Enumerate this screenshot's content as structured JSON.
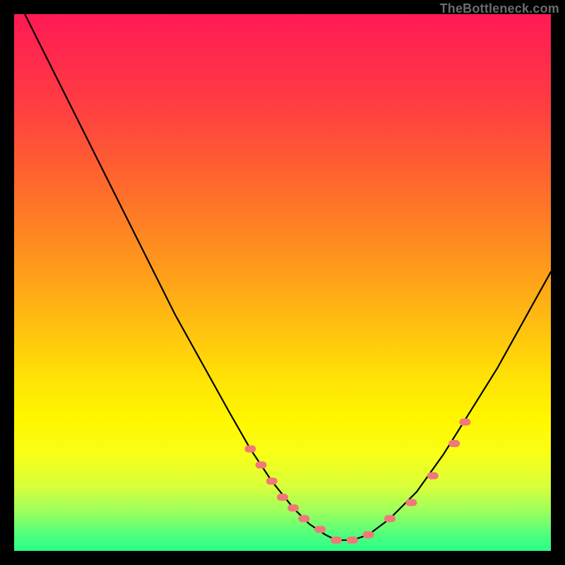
{
  "watermark": "TheBottleneck.com",
  "chart_data": {
    "type": "line",
    "title": "",
    "xlabel": "",
    "ylabel": "",
    "xlim": [
      0,
      100
    ],
    "ylim": [
      0,
      100
    ],
    "series": [
      {
        "name": "bottleneck-curve",
        "x": [
          2,
          5,
          10,
          15,
          20,
          25,
          30,
          35,
          40,
          44,
          48,
          52,
          55,
          58,
          60,
          63,
          66,
          70,
          75,
          80,
          85,
          90,
          95,
          100
        ],
        "values": [
          100,
          94,
          84,
          74,
          64,
          54,
          44,
          35,
          26,
          19,
          13,
          8,
          5,
          3,
          2,
          2,
          3,
          6,
          11,
          18,
          26,
          34,
          43,
          52
        ]
      }
    ],
    "markers": {
      "name": "highlighted-segment",
      "color": "#f07878",
      "x": [
        44,
        46,
        48,
        50,
        52,
        54,
        57,
        60,
        63,
        66,
        70,
        74,
        78,
        82,
        84
      ],
      "values": [
        19,
        16,
        13,
        10,
        8,
        6,
        4,
        2,
        2,
        3,
        6,
        9,
        14,
        20,
        24
      ]
    },
    "gradient_stops": [
      {
        "pos": 0,
        "color": "#ff1a55"
      },
      {
        "pos": 18,
        "color": "#ff4040"
      },
      {
        "pos": 45,
        "color": "#ff931e"
      },
      {
        "pos": 68,
        "color": "#ffe305"
      },
      {
        "pos": 88,
        "color": "#d8ff3a"
      },
      {
        "pos": 100,
        "color": "#2aff88"
      }
    ]
  }
}
